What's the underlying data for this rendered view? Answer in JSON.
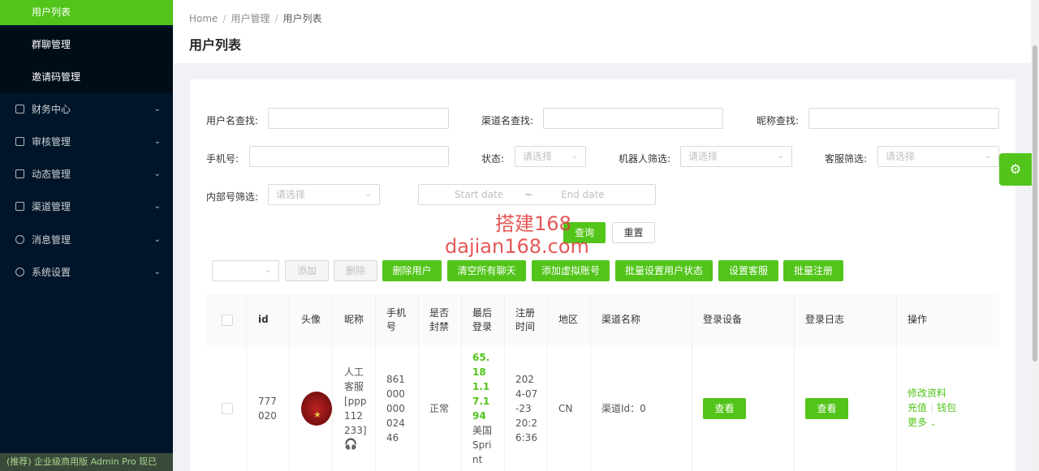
{
  "sidebar": {
    "submenu": [
      {
        "label": "用户列表",
        "active": true
      },
      {
        "label": "群聊管理"
      },
      {
        "label": "邀请码管理"
      }
    ],
    "menus": [
      {
        "label": "财务中心",
        "icon": "finance-icon"
      },
      {
        "label": "审核管理",
        "icon": "audit-icon"
      },
      {
        "label": "动态管理",
        "icon": "feed-icon"
      },
      {
        "label": "渠道管理",
        "icon": "channel-icon"
      },
      {
        "label": "消息管理",
        "icon": "message-icon"
      },
      {
        "label": "系统设置",
        "icon": "settings-icon"
      }
    ],
    "promo": "(推荐) 企业级商用版 Admin Pro 现已"
  },
  "header": {
    "breadcrumb": [
      "Home",
      "用户管理",
      "用户列表"
    ],
    "title": "用户列表"
  },
  "filters": {
    "username_label": "用户名查找:",
    "channel_label": "渠道名查找:",
    "nickname_label": "昵称查找:",
    "phone_label": "手机号:",
    "status_label": "状态:",
    "status_placeholder": "请选择",
    "robot_label": "机器人筛选:",
    "robot_placeholder": "请选择",
    "service_label": "客服筛选:",
    "service_placeholder": "请选择",
    "internal_label": "内部号筛选:",
    "internal_placeholder": "请选择",
    "start_date": "Start date",
    "range_sep": "~",
    "end_date": "End date",
    "query_button": "查询",
    "reset_button": "重置"
  },
  "watermark": {
    "line1": "搭建168",
    "line2": "dajian168.com"
  },
  "toolbar": {
    "add": "添加",
    "delete": "删除",
    "delete_user": "删除用户",
    "clear_chats": "清空所有聊天",
    "add_virtual": "添加虚拟账号",
    "batch_status": "批量设置用户状态",
    "set_service": "设置客服",
    "batch_register": "批量注册"
  },
  "table": {
    "headers": [
      "id",
      "头像",
      "昵称",
      "手机号",
      "是否封禁",
      "最后登录",
      "注册时间",
      "地区",
      "渠道名称",
      "登录设备",
      "登录日志",
      "操作"
    ],
    "row": {
      "id": "777020",
      "nickname": "人工客服[ppp112233]",
      "phone": "86100000002446",
      "banned": "正常",
      "last_login_ip": "65.181.17.194",
      "last_login_loc": "美国Sprint",
      "register_time": "2024-07-23 20:26:36",
      "region": "CN",
      "channel": "渠道Id：0",
      "device_btn": "查看",
      "log_btn": "查看",
      "actions": {
        "edit": "修改资料",
        "recharge": "充值",
        "wallet": "钱包",
        "more": "更多"
      }
    }
  }
}
